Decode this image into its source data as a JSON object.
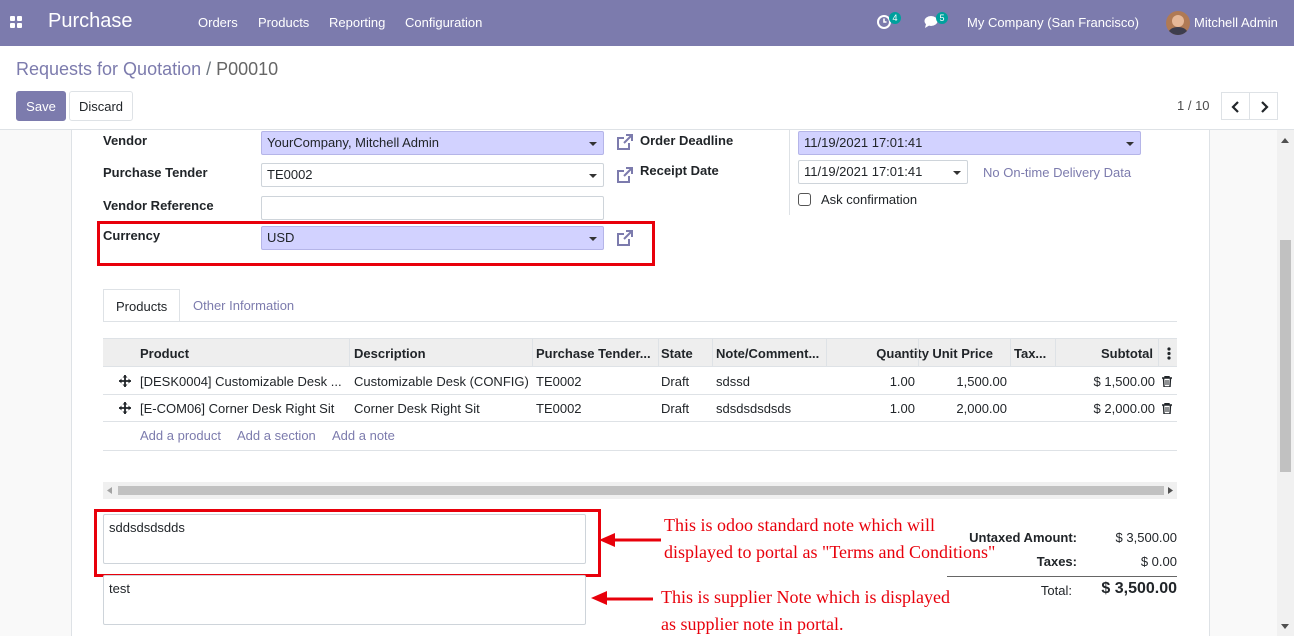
{
  "navbar": {
    "app_name": "Purchase",
    "menu": [
      "Orders",
      "Products",
      "Reporting",
      "Configuration"
    ],
    "activity_badge": "4",
    "messages_badge": "5",
    "company": "My Company (San Francisco)",
    "user": "Mitchell Admin",
    "color": "#7c7bad"
  },
  "breadcrumb": {
    "parent": "Requests for Quotation",
    "separator": "/",
    "current": "P00010"
  },
  "buttons": {
    "save": "Save",
    "discard": "Discard"
  },
  "pager": {
    "text": "1 / 10"
  },
  "form": {
    "vendor_label": "Vendor",
    "vendor_value": "YourCompany, Mitchell Admin",
    "tender_label": "Purchase Tender",
    "tender_value": "TE0002",
    "vendor_ref_label": "Vendor Reference",
    "vendor_ref_value": "",
    "currency_label": "Currency",
    "currency_value": "USD",
    "order_deadline_label": "Order Deadline",
    "order_deadline_value": "11/19/2021 17:01:41",
    "receipt_date_label": "Receipt Date",
    "receipt_date_value": "11/19/2021 17:01:41",
    "delivery_link": "No On-time Delivery Data",
    "ask_confirmation": "Ask confirmation"
  },
  "tabs": [
    {
      "label": "Products",
      "active": true
    },
    {
      "label": "Other Information",
      "active": false
    }
  ],
  "table": {
    "headers": [
      "Product",
      "Description",
      "Purchase Tender...",
      "State",
      "Note/Comment...",
      "Quantity",
      "Unit Price",
      "Tax...",
      "Subtotal"
    ],
    "rows": [
      [
        "[DESK0004] Customizable Desk ...",
        "Customizable Desk (CONFIG)",
        "TE0002",
        "Draft",
        "sdssd",
        "1.00",
        "1,500.00",
        "",
        "$ 1,500.00"
      ],
      [
        "[E-COM06] Corner Desk Right Sit",
        "Corner Desk Right Sit",
        "TE0002",
        "Draft",
        "sdsdsdsdsds",
        "1.00",
        "2,000.00",
        "",
        "$ 2,000.00"
      ]
    ],
    "add_links": [
      "Add a product",
      "Add a section",
      "Add a note"
    ]
  },
  "notes": {
    "terms": "sddsdsdsdds",
    "supplier": "test"
  },
  "totals": {
    "untaxed_label": "Untaxed Amount:",
    "untaxed_value": "$ 3,500.00",
    "taxes_label": "Taxes:",
    "taxes_value": "$ 0.00",
    "total_label": "Total:",
    "total_value": "$ 3,500.00"
  },
  "annotations": {
    "terms_line1": "This is odoo standard note which will",
    "terms_line2": "displayed to portal as \"Terms and Conditions\"",
    "supplier_line1": "This is supplier Note which is displayed",
    "supplier_line2": "as supplier note in portal.",
    "color": "#e8000b"
  }
}
